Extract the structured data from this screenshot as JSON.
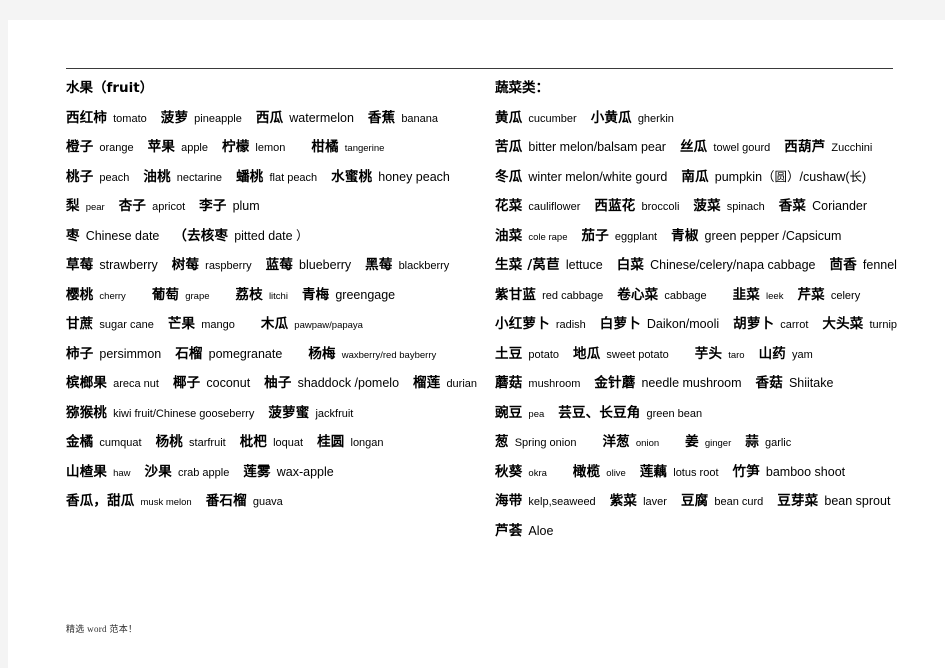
{
  "document": {
    "footer_note": "精选 word 范本！",
    "rule_color": "#3a3a3a",
    "page_background": "#ffffff",
    "margin_background": "#f4f4f4"
  },
  "fruit_section": {
    "heading": "水果（fruit）",
    "rows": [
      {
        "entries": [
          {
            "cn": "西红柿",
            "en": "tomato",
            "size": "m"
          },
          {
            "cn": "菠萝",
            "en": "pineapple",
            "size": "m"
          },
          {
            "cn": "西瓜",
            "en": "watermelon",
            "size": "l"
          },
          {
            "cn": "香蕉",
            "en": "banana",
            "size": "m"
          }
        ]
      },
      {
        "entries": [
          {
            "cn": "橙子",
            "en": "orange",
            "size": "m"
          },
          {
            "cn": "苹果",
            "en": "apple",
            "size": "m"
          },
          {
            "cn": "柠檬",
            "en": "lemon",
            "size": "m"
          },
          {
            "cn": "柑橘",
            "en": "tangerine",
            "size": "s"
          }
        ]
      },
      {
        "entries": [
          {
            "cn": "桃子",
            "en": "peach",
            "size": "m"
          },
          {
            "cn": "油桃",
            "en": "nectarine",
            "size": "m"
          },
          {
            "cn": "蟠桃",
            "en": "flat peach",
            "size": "m"
          },
          {
            "cn": "水蜜桃",
            "en": "honey peach",
            "size": "l"
          }
        ]
      },
      {
        "entries": [
          {
            "cn": "梨",
            "en": "pear",
            "size": "s"
          },
          {
            "cn": "杏子",
            "en": "apricot",
            "size": "m"
          },
          {
            "cn": "李子",
            "en": "plum",
            "size": "l"
          }
        ]
      },
      {
        "entries": [
          {
            "cn": "枣",
            "en": "Chinese date",
            "size": "l"
          },
          {
            "cn": "（去核枣",
            "en": "pitted date ）",
            "size": "l"
          }
        ]
      },
      {
        "entries": [
          {
            "cn": "草莓",
            "en": "strawberry",
            "size": "l"
          },
          {
            "cn": "树莓",
            "en": "raspberry",
            "size": "m"
          },
          {
            "cn": "蓝莓",
            "en": "blueberry",
            "size": "l"
          },
          {
            "cn": "黑莓",
            "en": "blackberry",
            "size": "m"
          }
        ]
      },
      {
        "entries": [
          {
            "cn": "樱桃",
            "en": "cherry",
            "size": "s"
          },
          {
            "cn": "葡萄",
            "en": "grape",
            "size": "s"
          },
          {
            "cn": "荔枝",
            "en": "litchi",
            "size": "s"
          },
          {
            "cn": "青梅",
            "en": "greengage",
            "size": "l"
          }
        ]
      },
      {
        "entries": [
          {
            "cn": "甘蔗",
            "en": "sugar cane",
            "size": "m"
          },
          {
            "cn": "芒果",
            "en": "mango",
            "size": "m"
          },
          {
            "cn": "木瓜",
            "en": "pawpaw/papaya",
            "size": "s"
          }
        ]
      },
      {
        "entries": [
          {
            "cn": "柿子",
            "en": "persimmon",
            "size": "l"
          },
          {
            "cn": "石榴",
            "en": "pomegranate",
            "size": "l"
          },
          {
            "cn": "杨梅",
            "en": "waxberry/red bayberry",
            "size": "s"
          }
        ]
      },
      {
        "entries": [
          {
            "cn": "槟榔果",
            "en": "areca nut",
            "size": "m"
          },
          {
            "cn": "椰子",
            "en": "coconut",
            "size": "l"
          },
          {
            "cn": "柚子",
            "en": "shaddock /pomelo",
            "size": "l"
          },
          {
            "cn": "榴莲",
            "en": "durian",
            "size": "m"
          }
        ]
      },
      {
        "entries": [
          {
            "cn": "猕猴桃",
            "en": "kiwi fruit/Chinese gooseberry",
            "size": "m"
          },
          {
            "cn": "菠萝蜜",
            "en": "jackfruit",
            "size": "m"
          }
        ]
      },
      {
        "entries": [
          {
            "cn": "金橘",
            "en": "cumquat",
            "size": "m"
          },
          {
            "cn": "杨桃",
            "en": "starfruit",
            "size": "m"
          },
          {
            "cn": "枇杷",
            "en": "loquat",
            "size": "m"
          },
          {
            "cn": "桂圆",
            "en": "longan",
            "size": "m"
          }
        ]
      },
      {
        "entries": [
          {
            "cn": "山楂果",
            "en": "haw",
            "size": "s"
          },
          {
            "cn": "沙果",
            "en": "crab apple",
            "size": "m"
          },
          {
            "cn": "莲雾",
            "en": "wax-apple",
            "size": "l"
          }
        ]
      },
      {
        "entries": [
          {
            "cn": "香瓜，甜瓜",
            "en": "musk melon",
            "size": "s"
          },
          {
            "cn": "番石榴",
            "en": "guava",
            "size": "m"
          }
        ]
      }
    ]
  },
  "vegetable_section": {
    "heading": "蔬菜类：",
    "rows": [
      {
        "entries": [
          {
            "cn": "黄瓜",
            "en": "cucumber",
            "size": "m"
          },
          {
            "cn": "小黄瓜",
            "en": "gherkin",
            "size": "m"
          }
        ]
      },
      {
        "entries": [
          {
            "cn": "苦瓜",
            "en": "bitter melon/balsam pear",
            "size": "l"
          },
          {
            "cn": "丝瓜",
            "en": "towel gourd",
            "size": "m"
          },
          {
            "cn": "西葫芦",
            "en": "Zucchini",
            "size": "m"
          }
        ]
      },
      {
        "entries": [
          {
            "cn": "冬瓜",
            "en": "winter melon/white gourd",
            "size": "l"
          },
          {
            "cn": "南瓜",
            "en": "pumpkin（圆）/cushaw(长)",
            "size": "l"
          }
        ]
      },
      {
        "entries": [
          {
            "cn": "花菜",
            "en": "cauliflower",
            "size": "m"
          },
          {
            "cn": "西蓝花",
            "en": "broccoli",
            "size": "m"
          },
          {
            "cn": "菠菜",
            "en": "spinach",
            "size": "m"
          },
          {
            "cn": "香菜",
            "en": "Coriander",
            "size": "l"
          }
        ]
      },
      {
        "entries": [
          {
            "cn": "油菜",
            "en": "cole rape",
            "size": "s"
          },
          {
            "cn": "茄子",
            "en": "eggplant",
            "size": "m"
          },
          {
            "cn": "青椒",
            "en": "green pepper /Capsicum",
            "size": "l"
          }
        ]
      },
      {
        "entries": [
          {
            "cn": "生菜 /莴苣",
            "en": "lettuce",
            "size": "l"
          },
          {
            "cn": "白菜",
            "en": "Chinese/celery/napa cabbage",
            "size": "l"
          },
          {
            "cn": "茴香",
            "en": "fennel",
            "size": "l"
          }
        ]
      },
      {
        "entries": [
          {
            "cn": "紫甘蓝",
            "en": "red cabbage",
            "size": "m"
          },
          {
            "cn": "卷心菜",
            "en": "cabbage",
            "size": "m"
          },
          {
            "cn": "韭菜",
            "en": "leek",
            "size": "s"
          },
          {
            "cn": "芹菜",
            "en": "celery",
            "size": "m"
          }
        ]
      },
      {
        "entries": [
          {
            "cn": "小红萝卜",
            "en": "radish",
            "size": "m"
          },
          {
            "cn": "白萝卜",
            "en": "Daikon/mooli",
            "size": "l"
          },
          {
            "cn": "胡萝卜",
            "en": "carrot",
            "size": "m"
          },
          {
            "cn": "大头菜",
            "en": "turnip",
            "size": "m"
          }
        ]
      },
      {
        "entries": [
          {
            "cn": "土豆",
            "en": "potato",
            "size": "m"
          },
          {
            "cn": "地瓜",
            "en": "sweet potato",
            "size": "m"
          },
          {
            "cn": "芋头",
            "en": "taro",
            "size": "s"
          },
          {
            "cn": "山药",
            "en": "yam",
            "size": "m"
          }
        ]
      },
      {
        "entries": [
          {
            "cn": "蘑菇",
            "en": "mushroom",
            "size": "m"
          },
          {
            "cn": "金针蘑",
            "en": "needle mushroom",
            "size": "l"
          },
          {
            "cn": "香菇",
            "en": "Shiitake",
            "size": "l"
          }
        ]
      },
      {
        "entries": [
          {
            "cn": "豌豆",
            "en": "pea",
            "size": "s"
          },
          {
            "cn": "芸豆、长豆角",
            "en": "green bean",
            "size": "m"
          }
        ]
      },
      {
        "entries": [
          {
            "cn": "葱",
            "en": "Spring onion",
            "size": "m"
          },
          {
            "cn": "洋葱",
            "en": "onion",
            "size": "s"
          },
          {
            "cn": "姜",
            "en": "ginger",
            "size": "s"
          },
          {
            "cn": "蒜",
            "en": "garlic",
            "size": "m"
          }
        ]
      },
      {
        "entries": [
          {
            "cn": "秋葵",
            "en": "okra",
            "size": "s"
          },
          {
            "cn": "橄榄",
            "en": "olive",
            "size": "s"
          },
          {
            "cn": "莲藕",
            "en": "lotus root",
            "size": "m"
          },
          {
            "cn": "竹笋",
            "en": "bamboo shoot",
            "size": "l"
          }
        ]
      },
      {
        "entries": [
          {
            "cn": "海带",
            "en": "kelp,seaweed",
            "size": "m"
          },
          {
            "cn": "紫菜",
            "en": "laver",
            "size": "m"
          },
          {
            "cn": "豆腐",
            "en": "bean curd",
            "size": "m"
          },
          {
            "cn": "豆芽菜",
            "en": "bean sprout",
            "size": "l"
          }
        ]
      },
      {
        "entries": [
          {
            "cn": "芦荟",
            "en": "Aloe",
            "size": "l"
          }
        ]
      }
    ]
  }
}
